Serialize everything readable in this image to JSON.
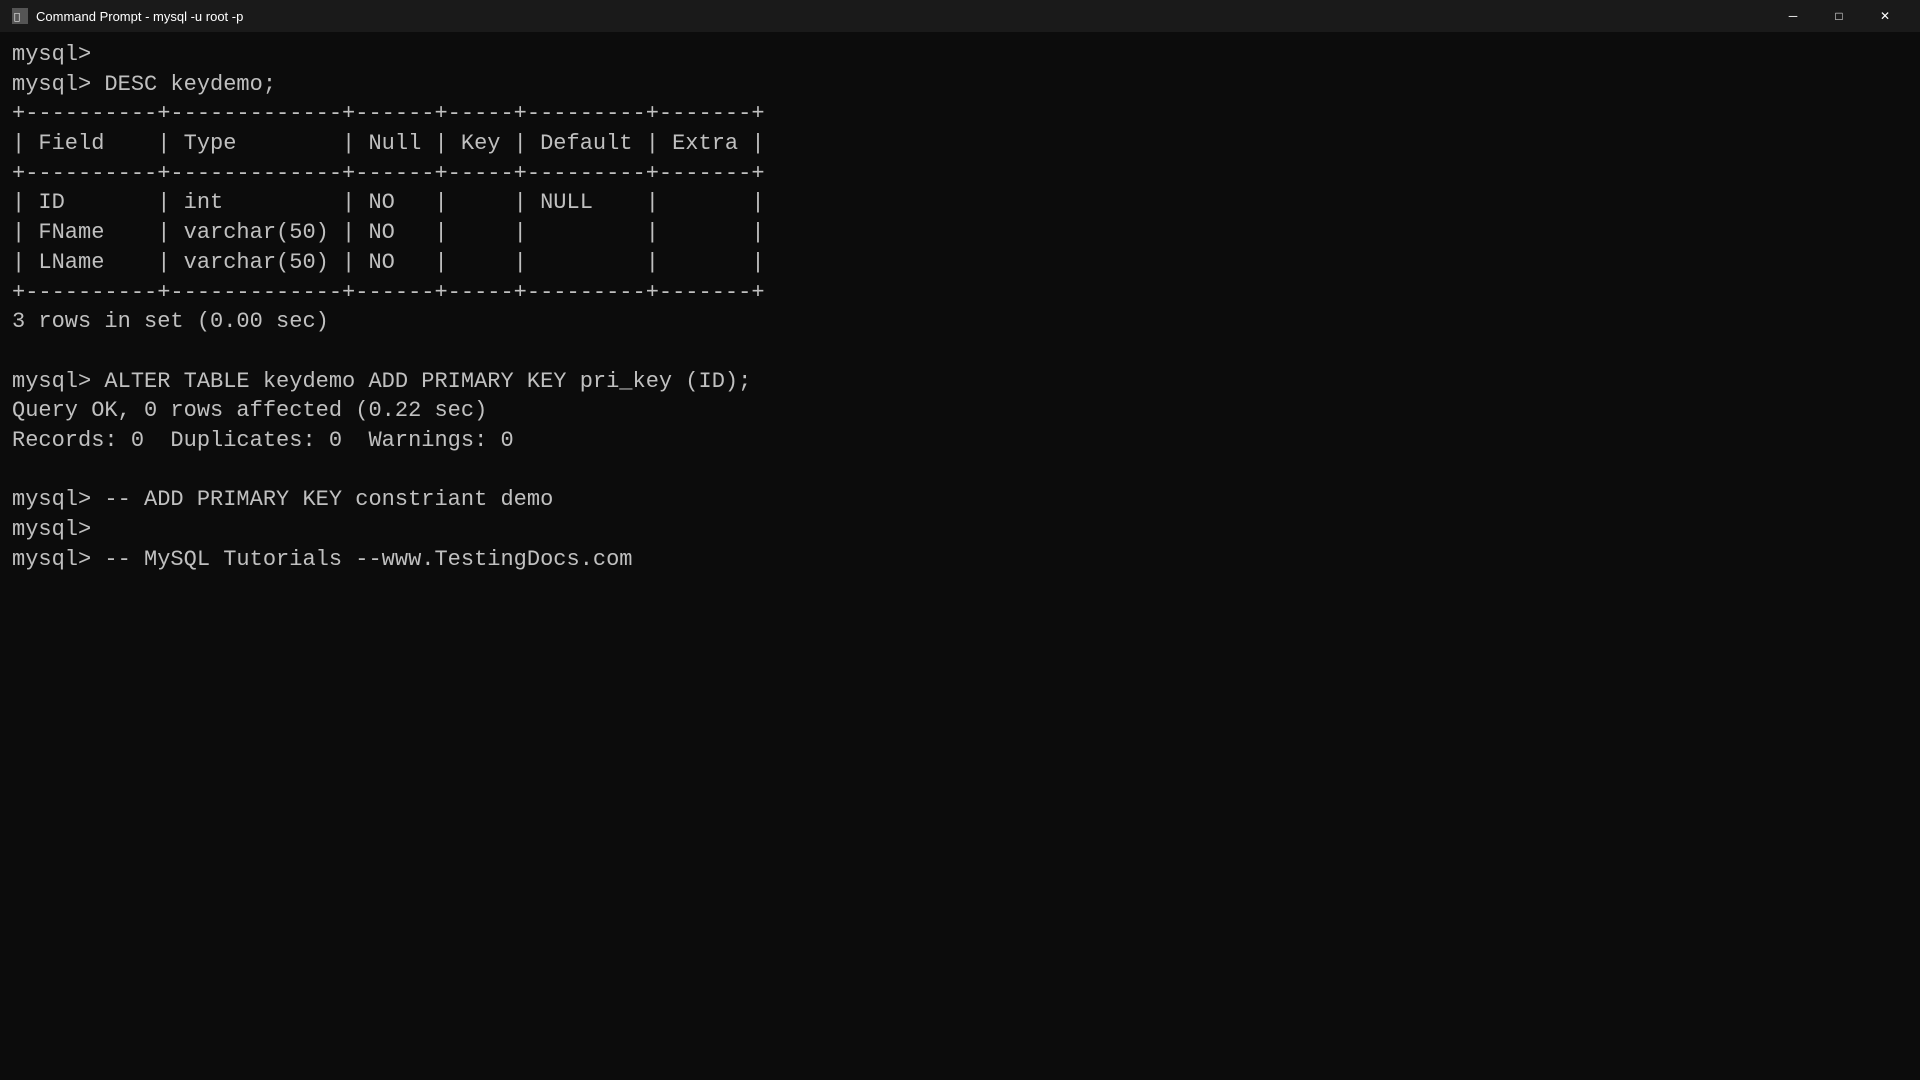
{
  "window": {
    "title": "Command Prompt - mysql  -u root -p",
    "icon": "cmd-icon"
  },
  "controls": {
    "minimize": "─",
    "maximize": "□",
    "close": "✕"
  },
  "terminal": {
    "lines": [
      "mysql>",
      "mysql> DESC keydemo;",
      "+----------+-------------+------+-----+---------+-------+",
      "| Field    | Type        | Null | Key | Default | Extra |",
      "+----------+-------------+------+-----+---------+-------+",
      "| ID       | int         | NO   |     | NULL    |       |",
      "| FName    | varchar(50) | NO   |     |         |       |",
      "| LName    | varchar(50) | NO   |     |         |       |",
      "+----------+-------------+------+-----+---------+-------+",
      "3 rows in set (0.00 sec)",
      "",
      "mysql> ALTER TABLE keydemo ADD PRIMARY KEY pri_key (ID);",
      "Query OK, 0 rows affected (0.22 sec)",
      "Records: 0  Duplicates: 0  Warnings: 0",
      "",
      "mysql> -- ADD PRIMARY KEY constriant demo",
      "mysql>",
      "mysql> -- MySQL Tutorials --www.TestingDocs.com"
    ]
  }
}
